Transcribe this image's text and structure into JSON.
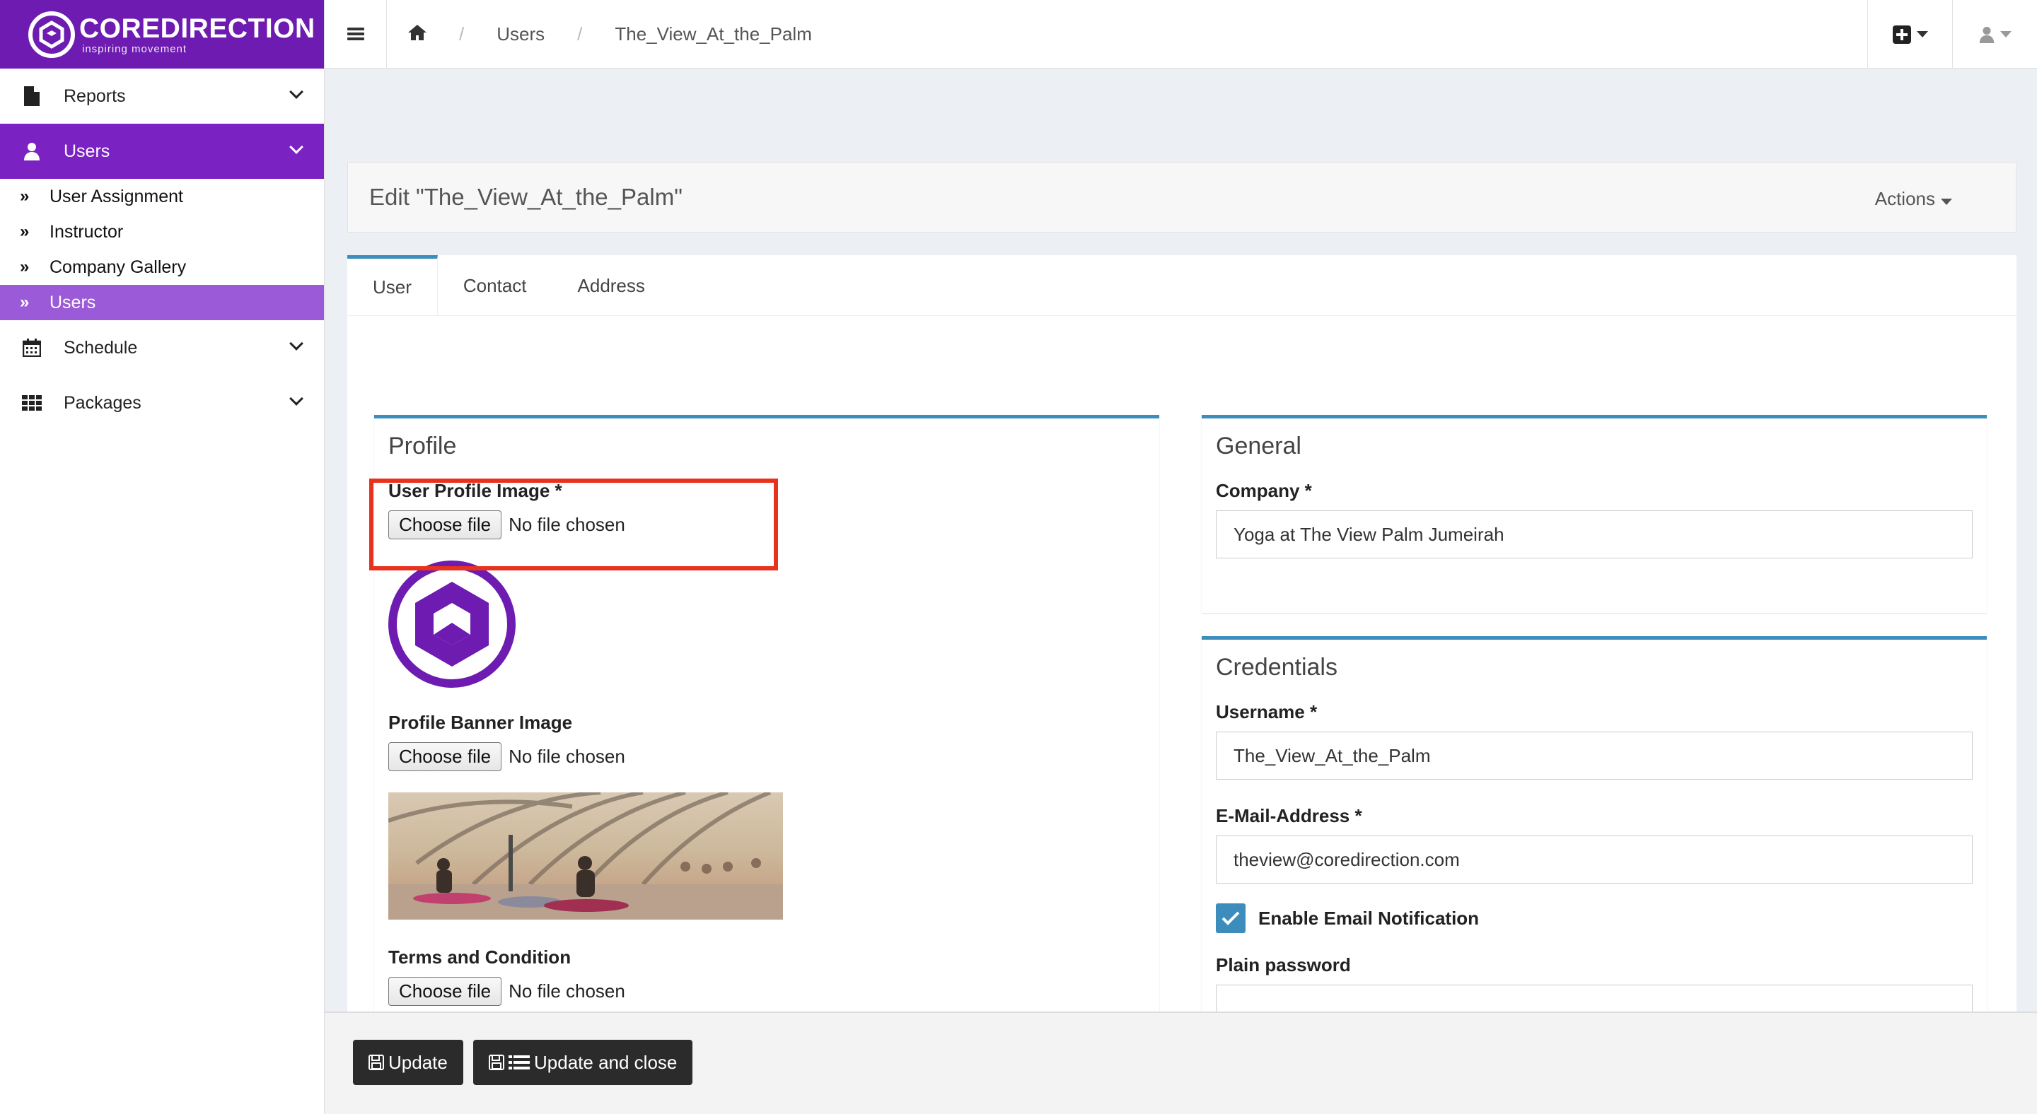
{
  "brand": {
    "name": "COREDIRECTION",
    "tagline": "inspiring movement",
    "color": "#6d1bb0"
  },
  "sidebar": {
    "items": [
      {
        "label": "Reports",
        "icon": "file-icon"
      },
      {
        "label": "Users",
        "icon": "user-icon",
        "active": true
      },
      {
        "label": "Schedule",
        "icon": "calendar-icon"
      },
      {
        "label": "Packages",
        "icon": "grid-icon"
      }
    ],
    "subitems": [
      {
        "label": "User Assignment"
      },
      {
        "label": "Instructor"
      },
      {
        "label": "Company Gallery"
      },
      {
        "label": "Users",
        "active": true
      }
    ]
  },
  "breadcrumb": {
    "home_icon": "home-icon",
    "items": [
      "Users",
      "The_View_At_the_Palm"
    ]
  },
  "page": {
    "title": "Edit \"The_View_At_the_Palm\"",
    "actions_label": "Actions",
    "tabs": [
      "User",
      "Contact",
      "Address"
    ]
  },
  "profile": {
    "heading": "Profile",
    "profile_image_label": "User Profile Image *",
    "banner_image_label": "Profile Banner Image",
    "terms_label": "Terms and Condition",
    "choose_file": "Choose file",
    "no_file": "No file chosen"
  },
  "general": {
    "heading": "General",
    "company_label": "Company *",
    "company_value": "Yoga at The View Palm Jumeirah"
  },
  "credentials": {
    "heading": "Credentials",
    "username_label": "Username *",
    "username_value": "The_View_At_the_Palm",
    "email_label": "E-Mail-Address *",
    "email_value": "theview@coredirection.com",
    "notify_label": "Enable Email Notification",
    "notify_checked": true,
    "password_label": "Plain password",
    "password_value": ""
  },
  "footer": {
    "update": "Update",
    "update_close": "Update and close"
  },
  "colors": {
    "accent": "#3c8dbc",
    "highlight": "#e8321e",
    "purple": "#7b22c2"
  }
}
